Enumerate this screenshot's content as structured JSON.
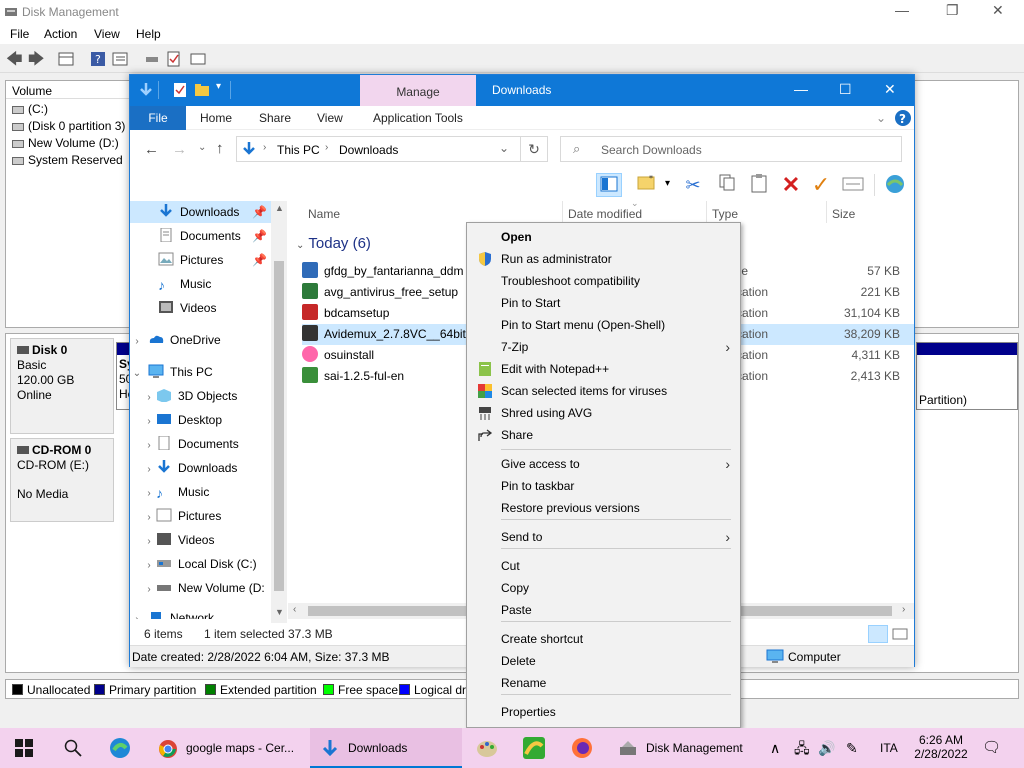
{
  "disk_management": {
    "title": "Disk Management",
    "menu": [
      "File",
      "Action",
      "View",
      "Help"
    ],
    "volume_header": "Volume",
    "volumes": [
      "(C:)",
      "(Disk 0 partition 3)",
      "New Volume (D:)",
      "System Reserved"
    ],
    "disk0": {
      "name": "Disk 0",
      "type": "Basic",
      "size": "120.00 GB",
      "status": "Online",
      "partition_label": "Sy",
      "partition_size": "50",
      "partition_status": "He",
      "right_label": "Partition)"
    },
    "cdrom": {
      "name": "CD-ROM 0",
      "type": "CD-ROM (E:)",
      "status": "No Media"
    },
    "legend": [
      {
        "label": "Unallocated",
        "color": "#000000"
      },
      {
        "label": "Primary partition",
        "color": "#00008b"
      },
      {
        "label": "Extended partition",
        "color": "#008000"
      },
      {
        "label": "Free space",
        "color": "#00ff00"
      },
      {
        "label": "Logical dr",
        "color": "#0000ff"
      }
    ]
  },
  "explorer": {
    "title": "Downloads",
    "manage_tab": "Manage",
    "tabs": {
      "file": "File",
      "home": "Home",
      "share": "Share",
      "view": "View",
      "application_tools": "Application Tools"
    },
    "breadcrumb": [
      "This PC",
      "Downloads"
    ],
    "search_placeholder": "Search Downloads",
    "nav_items": {
      "downloads": "Downloads",
      "documents": "Documents",
      "pictures": "Pictures",
      "music": "Music",
      "videos": "Videos",
      "onedrive": "OneDrive",
      "this_pc": "This PC",
      "objects3d": "3D Objects",
      "desktop": "Desktop",
      "pc_documents": "Documents",
      "pc_downloads": "Downloads",
      "pc_music": "Music",
      "pc_pictures": "Pictures",
      "pc_videos": "Videos",
      "local_disk": "Local Disk (C:)",
      "new_volume": "New Volume (D:",
      "network": "Network"
    },
    "columns": {
      "name": "Name",
      "date_modified": "Date modified",
      "type": "Type",
      "size": "Size"
    },
    "group_header": "Today (6)",
    "files": [
      {
        "name": "gfdg_by_fantarianna_ddm",
        "type": "ile",
        "size": "57 KB",
        "icon": "image-file-icon"
      },
      {
        "name": "avg_antivirus_free_setup",
        "type": "cation",
        "size": "221 KB",
        "icon": "avg-icon"
      },
      {
        "name": "bdcamsetup",
        "type": "cation",
        "size": "31,104 KB",
        "icon": "bandicam-icon"
      },
      {
        "name": "Avidemux_2.7.8VC__64bits",
        "type": "cation",
        "size": "38,209 KB",
        "icon": "avidemux-icon"
      },
      {
        "name": "osuinstall",
        "type": "cation",
        "size": "4,311 KB",
        "icon": "osu-icon"
      },
      {
        "name": "sai-1.2.5-ful-en",
        "type": "cation",
        "size": "2,413 KB",
        "icon": "sai-icon"
      }
    ],
    "status": {
      "items": "6 items",
      "selected": "1 item selected",
      "selected_size": "37.3 MB"
    },
    "details": {
      "text": "Date created: 2/28/2022 6:04 AM, Size: 37.3 MB",
      "location": "Computer"
    }
  },
  "context_menu": [
    {
      "label": "Open",
      "bold": true
    },
    {
      "label": "Run as administrator",
      "icon": "shield-icon"
    },
    {
      "label": "Troubleshoot compatibility"
    },
    {
      "label": "Pin to Start"
    },
    {
      "label": "Pin to Start menu (Open-Shell)"
    },
    {
      "label": "7-Zip",
      "submenu": true
    },
    {
      "label": "Edit with Notepad++",
      "icon": "notepadpp-icon"
    },
    {
      "label": "Scan selected items for viruses",
      "icon": "avg-scan-icon"
    },
    {
      "label": "Shred using AVG",
      "icon": "shred-icon"
    },
    {
      "label": "Share",
      "icon": "share-icon"
    },
    {
      "label": "Give access to",
      "submenu": true
    },
    {
      "label": "Pin to taskbar"
    },
    {
      "label": "Restore previous versions"
    },
    {
      "label": "Send to",
      "submenu": true
    },
    {
      "label": "Cut"
    },
    {
      "label": "Copy"
    },
    {
      "label": "Paste"
    },
    {
      "label": "Create shortcut"
    },
    {
      "label": "Delete"
    },
    {
      "label": "Rename"
    },
    {
      "label": "Properties"
    }
  ],
  "taskbar": {
    "chrome_label": "google maps - Cer...",
    "explorer_label": "Downloads",
    "dm_label": "Disk Management",
    "lang": "ITA",
    "time": "6:26 AM",
    "date": "2/28/2022",
    "accent": "#0078d4",
    "background": "#f3d2ee"
  }
}
